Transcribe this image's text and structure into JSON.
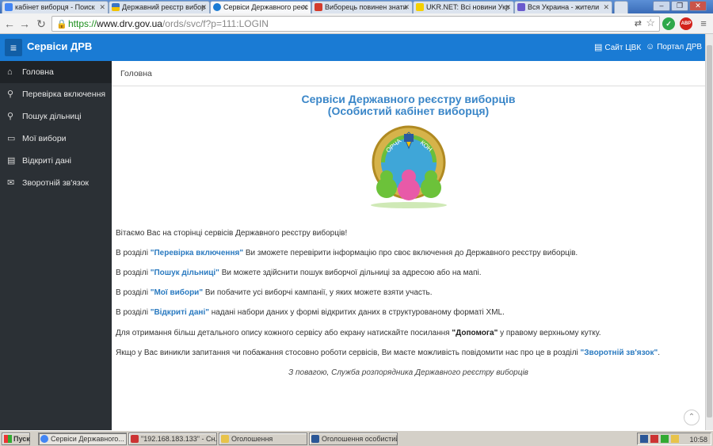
{
  "browser": {
    "tabs": [
      {
        "label": "кабінет виборця - Поиск",
        "color": "#4285f4"
      },
      {
        "label": "Державний реєстр вибор",
        "color": "#f2c200"
      },
      {
        "label": "Сервіси Державного реєс",
        "color": "#1a7bd4"
      },
      {
        "label": "Виборець повинен знати",
        "color": "#d33b2c"
      },
      {
        "label": "UKR.NET: Всі новини Укр",
        "color": "#f5d000"
      },
      {
        "label": "Вся Украина - жители",
        "color": "#6a5acd"
      }
    ],
    "url_scheme": "https://",
    "url_host": "www.drv.gov.ua",
    "url_path": "/ords/svc/f?p=111:LOGIN",
    "ext_adblock_label": "ABP"
  },
  "header": {
    "title": "Сервіси ДРВ",
    "link_cvk": "Сайт ЦВК",
    "link_portal": "Портал ДРВ"
  },
  "sidebar": {
    "items": [
      {
        "label": "Головна"
      },
      {
        "label": "Перевірка включення"
      },
      {
        "label": "Пошук дільниці"
      },
      {
        "label": "Мої вибори"
      },
      {
        "label": "Відкриті дані"
      },
      {
        "label": "Зворотній зв'язок"
      }
    ]
  },
  "main": {
    "breadcrumb": "Головна",
    "title_line1": "Сервіси Державного реєстру виборців",
    "title_line2": "(Особистий кабінет виборця)",
    "emblem_text_left": "ОРЧА",
    "emblem_text_right": "КОН",
    "welcome": "Вітаємо Вас на сторінці сервісів Державного реєстру виборців!",
    "p1": {
      "pre": "В розділі ",
      "link": "\"Перевірка включення\"",
      "post": " Ви зможете перевірити інформацію про своє включення до Державного реєстру виборців."
    },
    "p2": {
      "pre": "В розділі ",
      "link": "\"Пошук дільниці\"",
      "post": " Ви можете здійснити пошук виборчої дільниці за адресою або на мапі."
    },
    "p3": {
      "pre": "В розділі ",
      "link": "\"Мої вибори\"",
      "post": " Ви побачите усі виборчі кампанії, у яких можете взяти участь."
    },
    "p4": {
      "pre": "В розділі ",
      "link": "\"Відкриті дані\"",
      "post": " надані набори даних у формі відкритих даних в структурованому форматі XML."
    },
    "p5": {
      "pre": "Для отримання більш детального опису кожного сервісу або екрану натискайте посилання ",
      "link": "\"Допомога\"",
      "post": " у правому верхньому кутку."
    },
    "p6": {
      "pre": "Якщо у Вас виникли запитання чи побажання стосовно роботи сервісів, Ви маєте можливість повідомити нас про це в розділі ",
      "link": "\"Зворотній зв'язок\"",
      "post": "."
    },
    "signature": "З повагою, Служба розпорядника Державного реєстру виборців"
  },
  "taskbar": {
    "start": "Пуск",
    "tasks": [
      {
        "label": "Сервіси Державного..."
      },
      {
        "label": "\"192.168.183.133\" - Сн..."
      },
      {
        "label": "Оголошення"
      },
      {
        "label": "Оголошення особистий..."
      }
    ],
    "clock": "10:58"
  }
}
